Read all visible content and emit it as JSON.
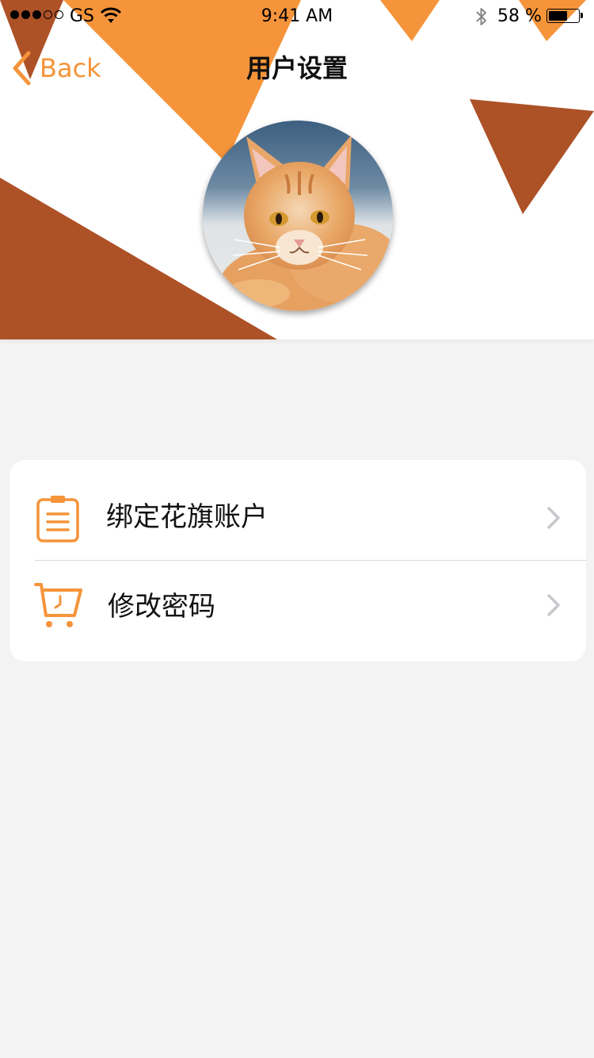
{
  "status_bar": {
    "carrier": "GS",
    "time": "9:41 AM",
    "battery_percent": "58 %",
    "battery_level": 0.58,
    "icons": [
      "signal-dots",
      "wifi-icon",
      "bluetooth-icon",
      "battery-icon"
    ]
  },
  "nav": {
    "back_label": "Back",
    "title": "用户设置"
  },
  "header": {
    "avatar": "cat-photo"
  },
  "settings": {
    "items": [
      {
        "label": "绑定花旗账户",
        "icon": "clipboard-icon"
      },
      {
        "label": "修改密码",
        "icon": "cart-icon"
      }
    ]
  },
  "colors": {
    "accent_orange": "#f5943a",
    "dark_orange": "#ad5127",
    "background": "#f3f3f3",
    "card": "#ffffff",
    "chevron": "#c7c7cc"
  }
}
